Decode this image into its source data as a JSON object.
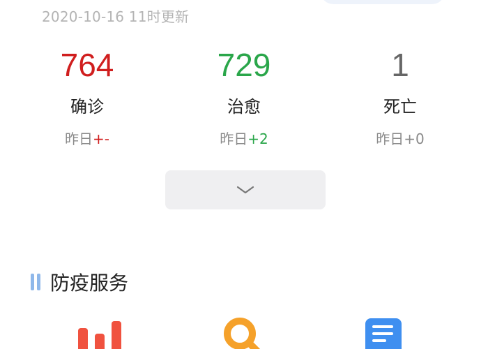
{
  "update_time": "2020-10-16 11时更新",
  "stats": [
    {
      "value": "764",
      "label": "确诊",
      "yesterday_prefix": "昨日",
      "yesterday_delta": "+-",
      "color": "#d01e1e"
    },
    {
      "value": "729",
      "label": "治愈",
      "yesterday_prefix": "昨日",
      "yesterday_delta": "+2",
      "color": "#2aa64a"
    },
    {
      "value": "1",
      "label": "死亡",
      "yesterday_prefix": "昨日",
      "yesterday_delta": "+0",
      "color": "#666666"
    }
  ],
  "expand_icon": "chevron-down-icon",
  "section": {
    "title": "防疫服务",
    "icon": "section-bar-icon"
  },
  "services": [
    {
      "icon": "bar-chart-icon",
      "color": "#f0523f"
    },
    {
      "icon": "search-icon",
      "color": "#f5a12a"
    },
    {
      "icon": "document-icon",
      "color": "#3f8ff0"
    }
  ]
}
